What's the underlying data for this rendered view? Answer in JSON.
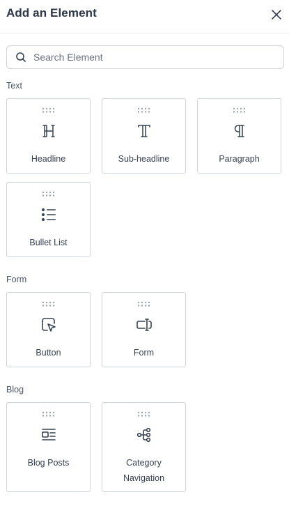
{
  "header": {
    "title": "Add an Element"
  },
  "search": {
    "placeholder": "Search Element",
    "value": ""
  },
  "sections": {
    "text": {
      "title": "Text",
      "items": [
        {
          "label": "Headline",
          "icon": "headline-icon"
        },
        {
          "label": "Sub-headline",
          "icon": "sub-headline-icon"
        },
        {
          "label": "Paragraph",
          "icon": "paragraph-icon"
        },
        {
          "label": "Bullet List",
          "icon": "bullet-list-icon"
        }
      ]
    },
    "form": {
      "title": "Form",
      "items": [
        {
          "label": "Button",
          "icon": "button-cursor-icon"
        },
        {
          "label": "Form",
          "icon": "form-input-icon"
        }
      ]
    },
    "blog": {
      "title": "Blog",
      "items": [
        {
          "label": "Blog Posts",
          "icon": "blog-posts-icon"
        },
        {
          "label": "Category Navigation",
          "label_line1": "Category",
          "label_line2": "Navigation",
          "icon": "category-navigation-icon"
        }
      ]
    }
  },
  "colors": {
    "icon": "#374151",
    "grip": "#9ca3af",
    "border": "#cfd4da"
  }
}
